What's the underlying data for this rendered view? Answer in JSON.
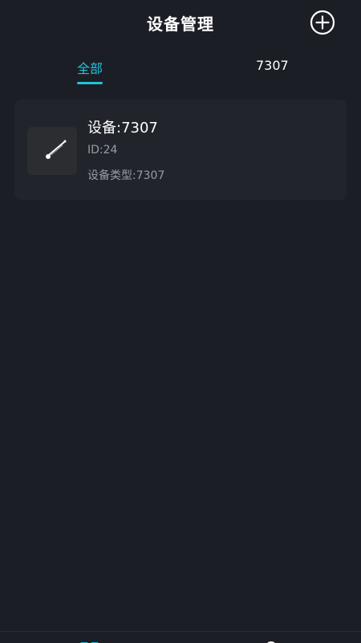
{
  "header": {
    "title": "设备管理",
    "add_icon": "plus-circle-icon"
  },
  "tabs": [
    {
      "label": "全部",
      "active": true
    },
    {
      "label": "7307",
      "active": false
    }
  ],
  "colors": {
    "background": "#1c1e25",
    "card": "#22242b",
    "accent": "#1fc3dc",
    "secondary_text": "#9a9ca3"
  },
  "devices": [
    {
      "name": "设备:7307",
      "id": "ID:24",
      "type": "设备类型:7307",
      "icon": "pen-device-icon"
    }
  ],
  "bottom_nav": [
    {
      "icon": "device-grid-icon",
      "active": true
    },
    {
      "icon": "user-icon",
      "active": false
    }
  ]
}
